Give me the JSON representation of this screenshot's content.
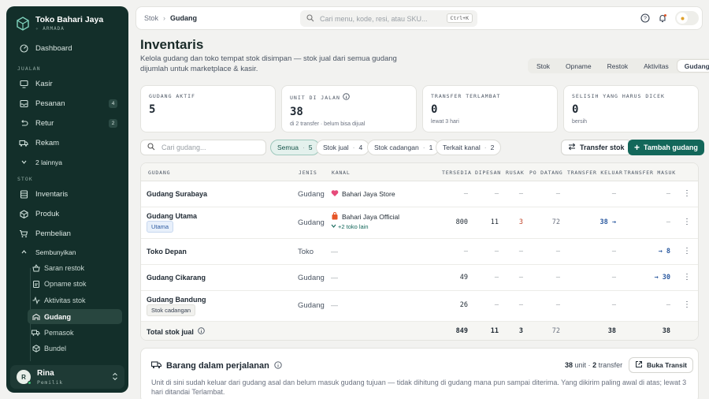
{
  "brand": {
    "name": "Toko Bahari Jaya",
    "tier": "ARMADA"
  },
  "nav": {
    "dashboard": "Dashboard",
    "sec_jualan": "JUALAN",
    "kasir": "Kasir",
    "pesanan": "Pesanan",
    "pesanan_badge": "4",
    "retur": "Retur",
    "retur_badge": "2",
    "rekam": "Rekam",
    "more": "2 lainnya",
    "sec_stok": "STOK",
    "inventaris": "Inventaris",
    "produk": "Produk",
    "pembelian": "Pembelian",
    "sembunyikan": "Sembunyikan",
    "sub": [
      "Saran restok",
      "Opname stok",
      "Aktivitas stok",
      "Gudang",
      "Pemasok",
      "Bundel"
    ]
  },
  "user": {
    "initial": "R",
    "name": "Rina",
    "role": "Pemilik"
  },
  "topbar": {
    "crumb1": "Stok",
    "crumb2": "Gudang",
    "search_placeholder": "Cari menu, kode, resi, atau SKU...",
    "shortcut": "Ctrl+K"
  },
  "page": {
    "title": "Inventaris",
    "description": "Kelola gudang dan toko tempat stok disimpan — stok jual dari semua gudang dijumlah untuk marketplace & kasir."
  },
  "tabs": [
    "Stok",
    "Opname",
    "Restok",
    "Aktivitas",
    "Gudang"
  ],
  "stats": [
    {
      "label": "GUDANG AKTIF",
      "value": "5",
      "sub": ""
    },
    {
      "label": "UNIT DI JALAN",
      "value": "38",
      "sub": "di 2 transfer · belum bisa dijual"
    },
    {
      "label": "TRANSFER TERLAMBAT",
      "value": "0",
      "sub": "lewat 3 hari"
    },
    {
      "label": "SELISIH YANG HARUS DICEK",
      "value": "0",
      "sub": "bersih"
    }
  ],
  "filters": {
    "search_placeholder": "Cari gudang...",
    "chips": [
      {
        "label": "Semua",
        "count": "5"
      },
      {
        "label": "Stok jual",
        "count": "4"
      },
      {
        "label": "Stok cadangan",
        "count": "1"
      },
      {
        "label": "Terkait kanal",
        "count": "2"
      }
    ],
    "transfer": "Transfer stok",
    "add": "Tambah gudang"
  },
  "table": {
    "headers": [
      "GUDANG",
      "JENIS",
      "KANAL",
      "TERSEDIA",
      "DIPESAN",
      "RUSAK",
      "PO DATANG",
      "TRANSFER KELUAR",
      "TRANSFER MASUK"
    ],
    "rows": [
      {
        "name": "Gudang Surabaya",
        "tag": "",
        "jenis": "Gudang",
        "kanal": "Bahari Jaya Store",
        "kanal_extra": "",
        "tersedia": "—",
        "dipesan": "—",
        "rusak": "—",
        "po": "—",
        "keluar": "—",
        "masuk": "—"
      },
      {
        "name": "Gudang Utama",
        "tag": "Utama",
        "jenis": "Gudang",
        "kanal": "Bahari Jaya Official",
        "kanal_extra": "+2 toko lain",
        "tersedia": "800",
        "dipesan": "11",
        "rusak": "3",
        "po": "72",
        "keluar": "38 →",
        "masuk": "—"
      },
      {
        "name": "Toko Depan",
        "tag": "",
        "jenis": "Toko",
        "kanal": "—",
        "kanal_extra": "",
        "tersedia": "—",
        "dipesan": "—",
        "rusak": "—",
        "po": "—",
        "keluar": "—",
        "masuk": "→ 8"
      },
      {
        "name": "Gudang Cikarang",
        "tag": "",
        "jenis": "Gudang",
        "kanal": "—",
        "kanal_extra": "",
        "tersedia": "49",
        "dipesan": "—",
        "rusak": "—",
        "po": "—",
        "keluar": "—",
        "masuk": "→ 30"
      },
      {
        "name": "Gudang Bandung",
        "tag": "Stok cadangan",
        "jenis": "Gudang",
        "kanal": "—",
        "kanal_extra": "",
        "tersedia": "26",
        "dipesan": "—",
        "rusak": "—",
        "po": "—",
        "keluar": "—",
        "masuk": "—"
      }
    ],
    "total": {
      "label": "Total stok jual",
      "tersedia": "849",
      "dipesan": "11",
      "rusak": "3",
      "po": "72",
      "keluar": "38",
      "masuk": "38"
    }
  },
  "transit": {
    "title": "Barang dalam perjalanan",
    "units": "38",
    "units_label": "unit ·",
    "transfers": "2",
    "transfers_label": "transfer",
    "button": "Buka Transit",
    "description": "Unit di sini sudah keluar dari gudang asal dan belum masuk gudang tujuan — tidak dihitung di gudang mana pun sampai diterima. Yang dikirim paling awal di atas; lewat 3 hari ditandai Terlambat."
  },
  "colors": {
    "sidebar": "#132f2a",
    "primary": "#13675a",
    "link": "#2c5aa0",
    "damaged": "#c0452b"
  }
}
